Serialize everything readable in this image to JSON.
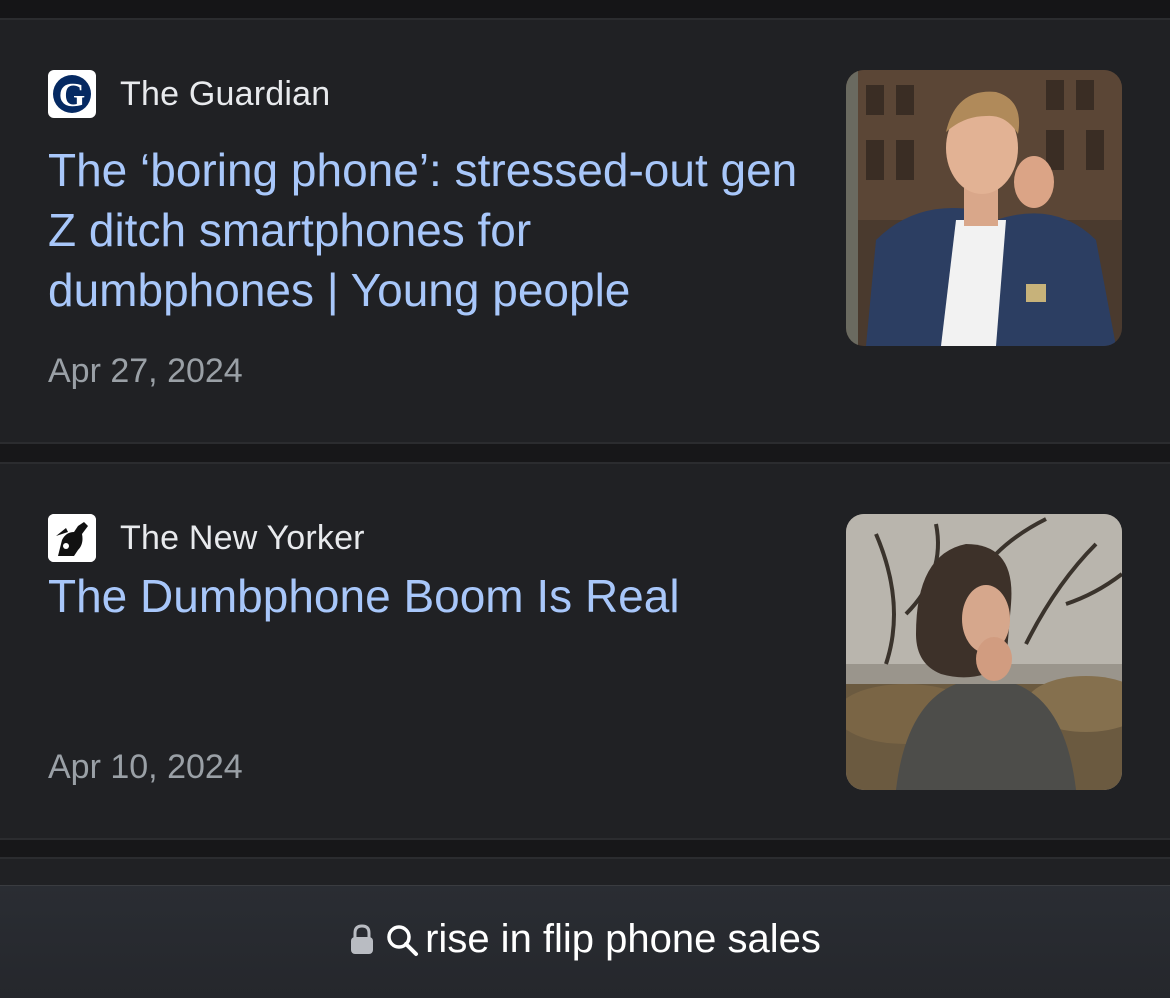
{
  "results": [
    {
      "source": "The Guardian",
      "headline": "The ‘boring phone’: stressed-out gen Z ditch smartphones for dumbphones | Young people",
      "date": "Apr 27, 2024",
      "favicon_icon": "guardian-g-logo",
      "thumbnail": "young-man-denim-jacket-on-phone"
    },
    {
      "source": "The New Yorker",
      "headline": "The Dumbphone Boom Is Real",
      "date": "Apr 10, 2024",
      "favicon_icon": "new-yorker-eustace-tilley-logo",
      "thumbnail": "person-on-phone-outdoors"
    }
  ],
  "address_bar": {
    "text": "rise in flip phone sales",
    "lock_icon": "lock-icon",
    "search_icon": "search-icon"
  },
  "colors": {
    "headline": "#a8c7fa",
    "source": "#e8eaed",
    "date": "#9aa0a6",
    "card_bg": "#202124"
  }
}
